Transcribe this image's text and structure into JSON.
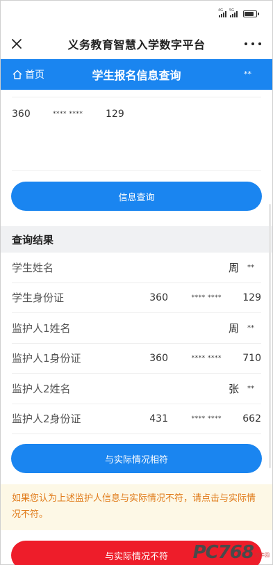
{
  "status": {
    "sig1_tag": "4G",
    "sig2_tag": "5G"
  },
  "app": {
    "title": "义务教育智慧入学数字平台"
  },
  "nav": {
    "home_label": "首页",
    "title": "学生报名信息查询",
    "extra": "**"
  },
  "query_form": {
    "id_part1": "360",
    "id_mask": "**** ****",
    "id_part3": "129"
  },
  "buttons": {
    "query": "信息查询",
    "confirm": "与实际情况相符",
    "deny": "与实际情况不符"
  },
  "results": {
    "header": "查询结果",
    "rows": [
      {
        "label": "学生姓名",
        "name": "周",
        "name_mask": "**"
      },
      {
        "label": "学生身份证",
        "id_part1": "360",
        "id_mask": "**** ****",
        "id_part3": "129"
      },
      {
        "label": "监护人1姓名",
        "name": "周",
        "name_mask": "**"
      },
      {
        "label": "监护人1身份证",
        "id_part1": "360",
        "id_mask": "**** ****",
        "id_part3": "710"
      },
      {
        "label": "监护人2姓名",
        "name": "张",
        "name_mask": "**"
      },
      {
        "label": "监护人2身份证",
        "id_part1": "431",
        "id_mask": "**** ****",
        "id_part3": "662"
      }
    ]
  },
  "notice": "如果您认为上述监护人信息与实际情况不符，请点击与实际情况不符。",
  "watermark": {
    "text": "PC768",
    "sub": "软件园"
  },
  "colors": {
    "primary": "#1a85f0",
    "danger": "#ee1d2a",
    "notice_text": "#e07b1a",
    "notice_bg": "#fdf8e6"
  }
}
